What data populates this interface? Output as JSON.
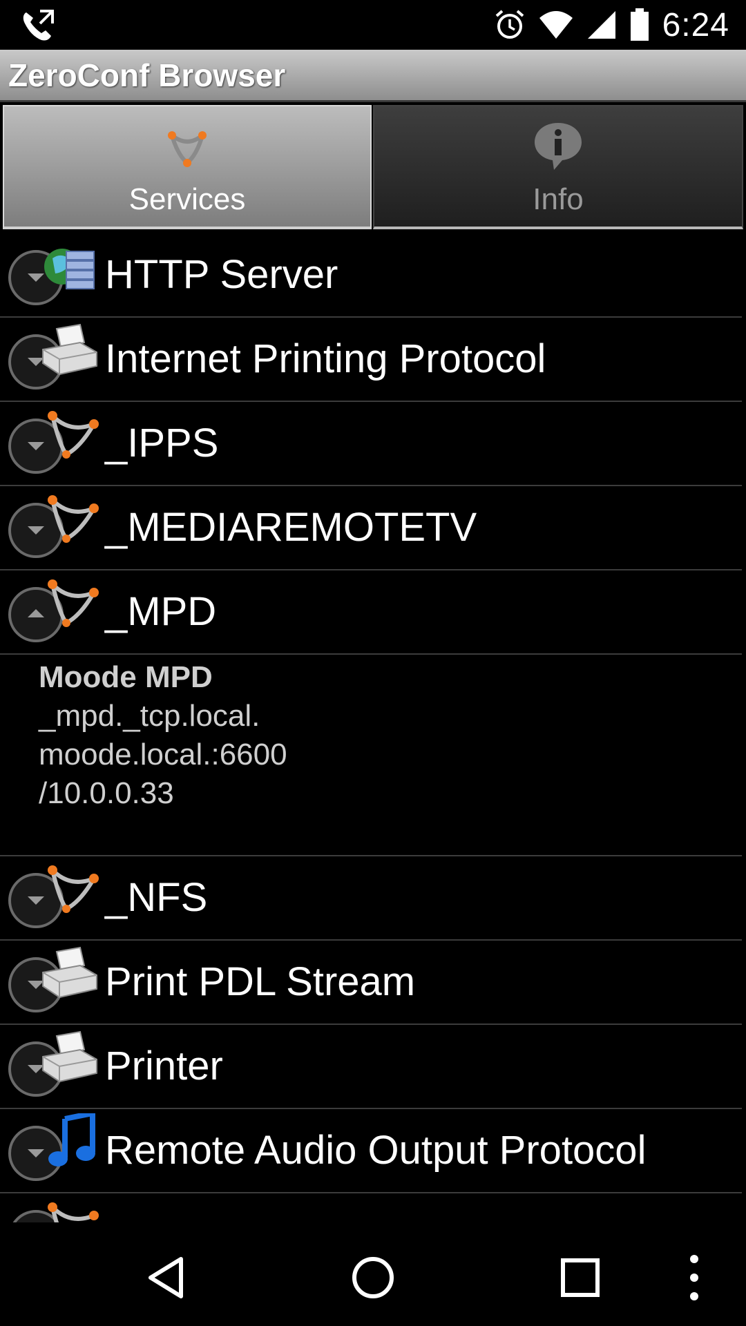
{
  "status_bar": {
    "time": "6:24",
    "icons": [
      "phone-call-icon",
      "alarm-icon",
      "wifi-icon",
      "cell-signal-icon",
      "battery-icon"
    ]
  },
  "app": {
    "title": "ZeroConf Browser"
  },
  "tabs": [
    {
      "label": "Services",
      "icon": "network-nodes-icon",
      "selected": true
    },
    {
      "label": "Info",
      "icon": "info-bubble-icon",
      "selected": false
    }
  ],
  "services": [
    {
      "label": "HTTP Server",
      "icon": "web-server-icon",
      "expanded": false
    },
    {
      "label": "Internet Printing Protocol",
      "icon": "printer-icon",
      "expanded": false
    },
    {
      "label": "_IPPS",
      "icon": "network-nodes-icon",
      "expanded": false
    },
    {
      "label": "_MEDIAREMOTETV",
      "icon": "network-nodes-icon",
      "expanded": false
    },
    {
      "label": "_MPD",
      "icon": "network-nodes-icon",
      "expanded": true
    },
    {
      "label": "_NFS",
      "icon": "network-nodes-icon",
      "expanded": false
    },
    {
      "label": "Print PDL Stream",
      "icon": "printer-icon",
      "expanded": false
    },
    {
      "label": "Printer",
      "icon": "printer-icon",
      "expanded": false
    },
    {
      "label": "Remote Audio Output Protocol",
      "icon": "music-note-icon",
      "expanded": false
    }
  ],
  "mpd_detail": {
    "name": "Moode MPD",
    "type": "_mpd._tcp.local.",
    "host": "moode.local.:6600",
    "address": "/10.0.0.33"
  },
  "nav": [
    "back-icon",
    "home-icon",
    "recents-icon",
    "overflow-menu-icon"
  ],
  "colors": {
    "accent_orange": "#f07a20",
    "divider": "#3c3c3c",
    "title_bar": "#a9a9a9"
  }
}
